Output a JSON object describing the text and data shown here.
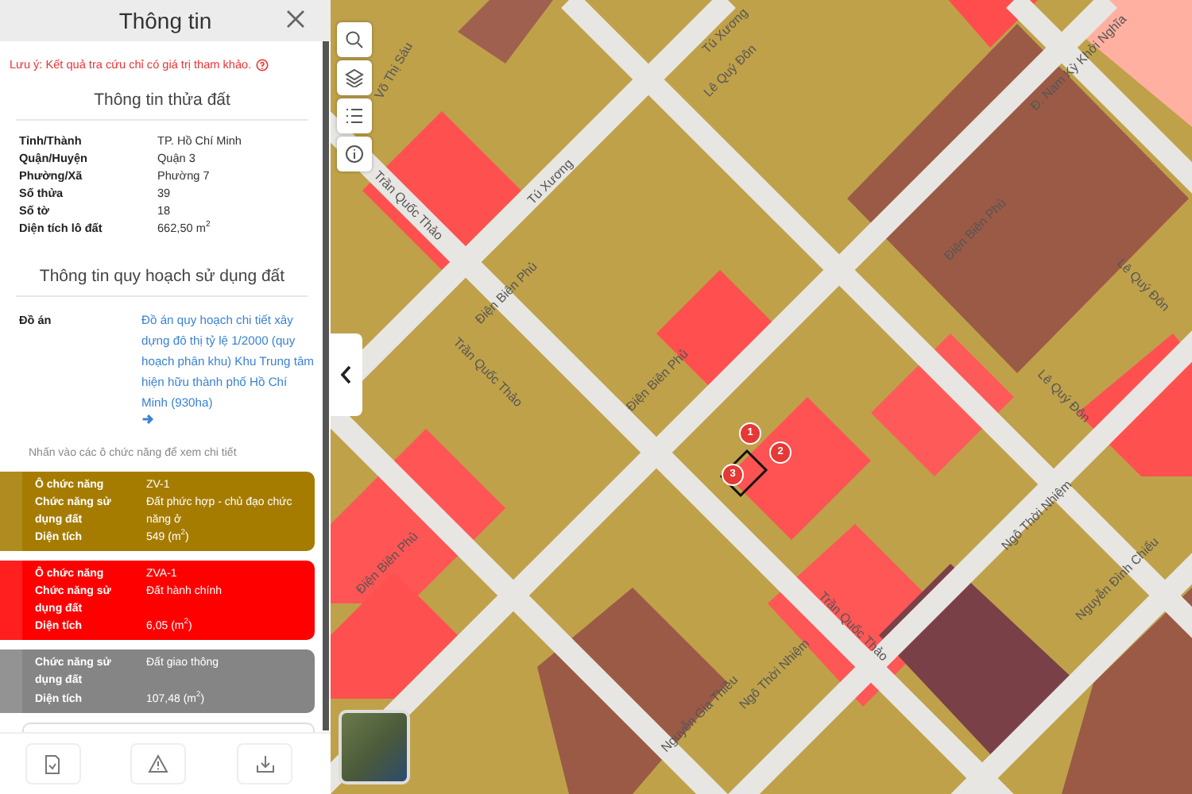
{
  "panel": {
    "title": "Thông tin",
    "note": "Lưu ý: Kết quả tra cứu chỉ có giá trị tham khảo.",
    "parcel": {
      "title": "Thông tin thửa đất",
      "rows": [
        {
          "label": "Tỉnh/Thành",
          "value": "TP. Hồ Chí Minh"
        },
        {
          "label": "Quận/Huyện",
          "value": "Quận 3"
        },
        {
          "label": "Phường/Xã",
          "value": "Phường 7"
        },
        {
          "label": "Số thửa",
          "value": "39"
        },
        {
          "label": "Số tờ",
          "value": "18"
        },
        {
          "label": "Diện tích lô đất",
          "value": "662,50 m$^{2}$"
        }
      ]
    },
    "planning": {
      "title": "Thông tin quy hoạch sử dụng đất",
      "project_label": "Đồ án",
      "project_link": "Đồ án quy hoạch chi tiết xây dựng đô thị tỷ lệ 1/2000 (quy hoạch phân khu) Khu Trung tâm hiện hữu thành phố Hồ Chí Minh (930ha)",
      "hint": "Nhấn vào các ô chức năng để xem chi tiết"
    },
    "cards": [
      {
        "color": "#a67c00",
        "rows": [
          {
            "label": "Ô chức năng",
            "value": "ZV-1"
          },
          {
            "label": "Chức năng sử dụng đất",
            "value": "Đất phức hợp - chủ đạo chức năng ở"
          },
          {
            "label": "Diện tích",
            "value": "549 (m$^{2}$)"
          }
        ]
      },
      {
        "color": "#ff0000",
        "rows": [
          {
            "label": "Ô chức năng",
            "value": "ZVA-1"
          },
          {
            "label": "Chức năng sử dụng đất",
            "value": "Đất hành chính"
          },
          {
            "label": "Diện tích",
            "value": "6,05 (m$^{2}$)"
          }
        ]
      },
      {
        "color": "#858585",
        "rows": [
          {
            "label": "Chức năng sử dụng đất",
            "value": "Đất giao thông"
          },
          {
            "label": "Diện tích",
            "value": "107,48 (m$^{2}$)"
          }
        ]
      }
    ]
  },
  "map": {
    "streets": [
      {
        "text": "Võ Thị Sáu"
      },
      {
        "text": "Tú Xương"
      },
      {
        "text": "Tú Xương"
      },
      {
        "text": "Lê Quý Đôn"
      },
      {
        "text": "Điện Biên Phủ"
      },
      {
        "text": "Điện Biên Phủ"
      },
      {
        "text": "Điện Biên Phủ"
      },
      {
        "text": "Điện Biên Phủ"
      },
      {
        "text": "Trần Quốc Thảo"
      },
      {
        "text": "Trần Quốc Thảo"
      },
      {
        "text": "Trần Quốc Thảo"
      },
      {
        "text": "Lê Quý Đôn"
      },
      {
        "text": "Lê Quý Đôn"
      },
      {
        "text": "Ngô Thời Nhiệm"
      },
      {
        "text": "Ngô Thời Nhiệm"
      },
      {
        "text": "Nguyễn Gia Thiều"
      },
      {
        "text": "Đ. Nam Kỳ Khởi Nghĩa"
      },
      {
        "text": "Nguyễn Đình Chiểu"
      }
    ],
    "markers": [
      {
        "label": "1"
      },
      {
        "label": "2"
      },
      {
        "label": "3"
      }
    ]
  }
}
